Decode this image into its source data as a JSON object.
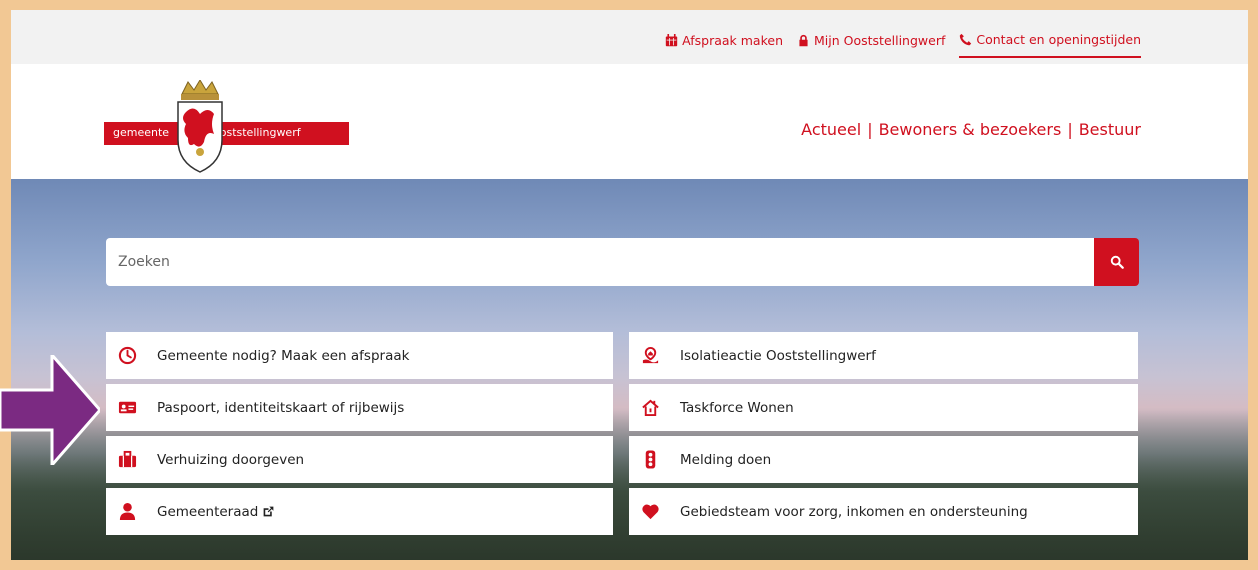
{
  "toplinks": {
    "appointment": "Afspraak maken",
    "mijn": "Mijn Ooststellingwerf",
    "contact": "Contact en openingstijden"
  },
  "logo": {
    "left": "gemeente",
    "right": "ooststellingwerf"
  },
  "nav": {
    "actueel": "Actueel",
    "bewoners": "Bewoners & bezoekers",
    "bestuur": "Bestuur",
    "separator": "|"
  },
  "search": {
    "placeholder": "Zoeken"
  },
  "tiles_left": [
    {
      "label": "Gemeente nodig? Maak een afspraak",
      "icon": "clock-icon"
    },
    {
      "label": "Paspoort, identiteitskaart of rijbewijs",
      "icon": "id-card-icon"
    },
    {
      "label": "Verhuizing doorgeven",
      "icon": "suitcase-icon"
    },
    {
      "label": "Gemeenteraad",
      "icon": "user-icon"
    }
  ],
  "tiles_right": [
    {
      "label": "Isolatieactie Ooststellingwerf",
      "icon": "house-insulation-icon"
    },
    {
      "label": "Taskforce Wonen",
      "icon": "home-icon"
    },
    {
      "label": "Melding doen",
      "icon": "traffic-light-icon"
    },
    {
      "label": "Gebiedsteam voor zorg, inkomen en ondersteuning",
      "icon": "heart-icon"
    }
  ],
  "colors": {
    "brand_red": "#d0101f",
    "frame": "#f2c894",
    "arrow": "#7b2a82"
  }
}
